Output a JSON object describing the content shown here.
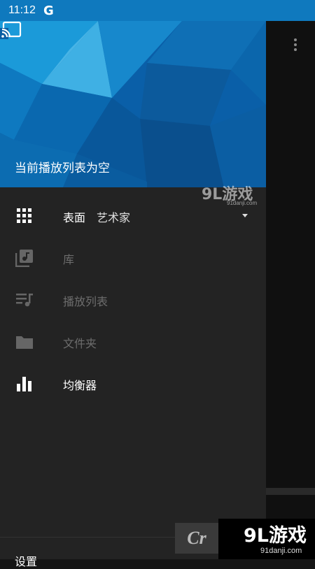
{
  "status_bar": {
    "time": "11:12",
    "g_logo": "G"
  },
  "header": {
    "empty_playlist_text": "当前播放列表为空",
    "cast_icon": "cast-icon",
    "background": "blue-polygon-art"
  },
  "menu": [
    {
      "icon": "grid-icon",
      "label": "表面",
      "sub": "艺术家",
      "has_dropdown": true,
      "dim": false
    },
    {
      "icon": "library-music-icon",
      "label": "库",
      "dim": true
    },
    {
      "icon": "playlist-icon",
      "label": "播放列表",
      "dim": true
    },
    {
      "icon": "folder-icon",
      "label": "文件夹",
      "dim": true
    },
    {
      "icon": "equalizer-icon",
      "label": "均衡器",
      "dim": false
    }
  ],
  "footer": {
    "settings_label": "设置"
  },
  "watermarks": {
    "left_partial_text": "Cr",
    "mid_text_big": "9L游戏",
    "mid_text_small": "91danji.com",
    "bottom_text_big": "9L游戏",
    "bottom_text_small": "91danji.com"
  },
  "colors": {
    "status_bar": "#0F79BE",
    "drawer_bg": "#232323",
    "dim_text": "#6d6d6d"
  }
}
